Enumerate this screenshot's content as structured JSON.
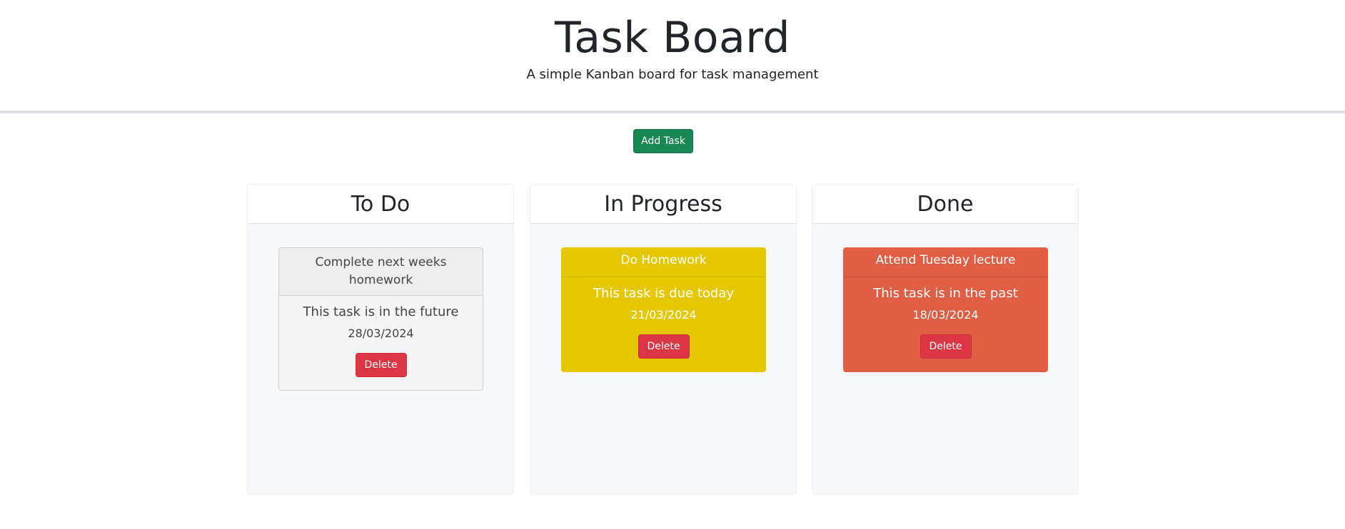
{
  "header": {
    "title": "Task Board",
    "subtitle": "A simple Kanban board for task management"
  },
  "toolbar": {
    "add_task_label": "Add Task",
    "add_task_color": "#198754"
  },
  "columns": [
    {
      "title": "To Do",
      "cards": [
        {
          "title": "Complete next weeks homework",
          "description": "This task is in the future",
          "date": "28/03/2024",
          "delete_label": "Delete",
          "status": "future",
          "color": "#f5f5f5"
        }
      ]
    },
    {
      "title": "In Progress",
      "cards": [
        {
          "title": "Do Homework",
          "description": "This task is due today",
          "date": "21/03/2024",
          "delete_label": "Delete",
          "status": "today",
          "color": "#e6c800"
        }
      ]
    },
    {
      "title": "Done",
      "cards": [
        {
          "title": "Attend Tuesday lecture",
          "description": "This task is in the past",
          "date": "18/03/2024",
          "delete_label": "Delete",
          "status": "past",
          "color": "#e05e44"
        }
      ]
    }
  ],
  "colors": {
    "delete_button": "#dc3545",
    "column_background": "#f7f8f9"
  }
}
